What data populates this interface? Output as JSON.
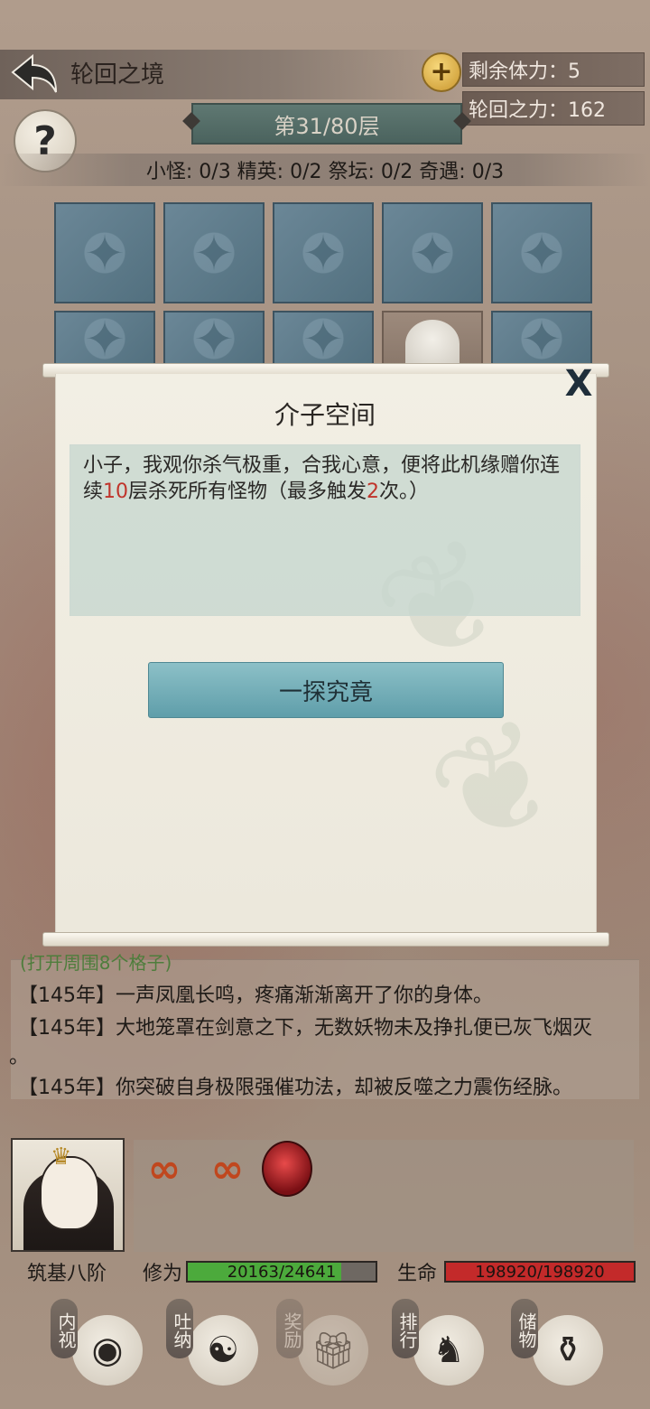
{
  "header": {
    "title": "轮回之境",
    "stamina": "剩余体力：5",
    "reincarnation_power": "轮回之力：162",
    "help": "?"
  },
  "floor": {
    "label": "第31/80层",
    "counts": "小怪: 0/3 精英: 0/2 祭坛: 0/2 奇遇: 0/3"
  },
  "modal": {
    "title": "介子空间",
    "close": "X",
    "text_prefix": "小子，我观你杀气极重，合我心意，便将此机缘赠你连续",
    "text_num1": "10",
    "text_mid": "层杀死所有怪物（最多触发",
    "text_num2": "2",
    "text_suffix": "次。）",
    "button": "一探究竟"
  },
  "log": {
    "partial": "(打开周围8个格子)",
    "lines": [
      "【145年】一声凤凰长鸣，疼痛渐渐离开了你的身体。",
      "【145年】大地笼罩在剑意之下，无数妖物未及挣扎便已灰飞烟灭",
      "。",
      "【145年】你突破自身极限强催功法，却被反噬之力震伤经脉。"
    ]
  },
  "player": {
    "realm": "筑基八阶",
    "cultivation_label": "修为",
    "cultivation_value": "20163/24641",
    "cultivation_fraction": 0.818,
    "life_label": "生命",
    "life_value": "198920/198920",
    "life_fraction": 1.0
  },
  "nav": {
    "items": [
      {
        "label": "内视",
        "icon": "eye-icon"
      },
      {
        "label": "吐纳",
        "icon": "meditation-icon"
      },
      {
        "label": "奖励",
        "icon": "gift-icon"
      },
      {
        "label": "排行",
        "icon": "ranking-icon"
      },
      {
        "label": "储物",
        "icon": "bag-icon"
      }
    ]
  },
  "colors": {
    "cultivation_bar": "#4caa3c",
    "life_bar": "#c32a2a",
    "accent_button": "#6aa8b3"
  }
}
